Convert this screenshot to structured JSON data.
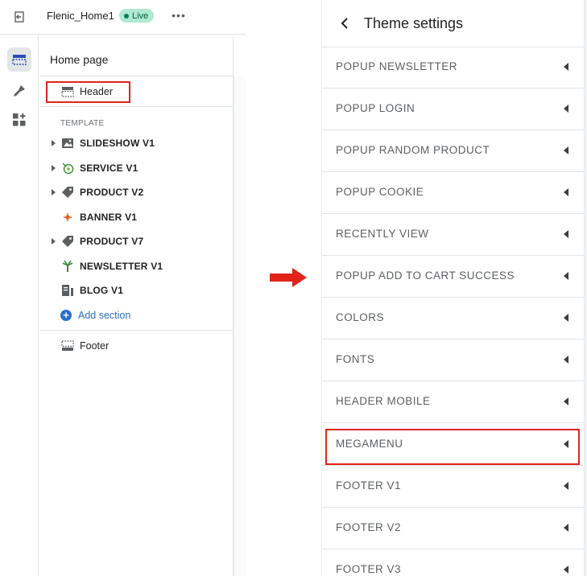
{
  "topbar": {
    "store_name": "Flenic_Home1",
    "status_badge": "Live",
    "more_label": "•••"
  },
  "rail": {
    "items": [
      {
        "icon": "sections-icon",
        "active": true
      },
      {
        "icon": "theme-brush-icon",
        "active": false
      },
      {
        "icon": "apps-icon",
        "active": false
      }
    ]
  },
  "tree": {
    "page_title": "Home page",
    "header_label": "Header",
    "template_label": "TEMPLATE",
    "sections": [
      {
        "label": "SLIDESHOW V1",
        "icon": "image-icon",
        "expandable": true
      },
      {
        "label": "SERVICE V1",
        "icon": "service-icon",
        "expandable": true
      },
      {
        "label": "PRODUCT V2",
        "icon": "tag-icon",
        "expandable": true
      },
      {
        "label": "BANNER V1",
        "icon": "banner-icon",
        "expandable": false
      },
      {
        "label": "PRODUCT V7",
        "icon": "tag-icon",
        "expandable": true
      },
      {
        "label": "NEWSLETTER V1",
        "icon": "newsletter-icon",
        "expandable": false
      },
      {
        "label": "BLOG V1",
        "icon": "blog-icon",
        "expandable": false
      }
    ],
    "add_section_label": "Add section",
    "footer_label": "Footer"
  },
  "settings": {
    "title": "Theme settings",
    "items": [
      "POPUP NEWSLETTER",
      "POPUP LOGIN",
      "POPUP RANDOM PRODUCT",
      "POPUP COOKIE",
      "RECENTLY VIEW",
      "POPUP ADD TO CART SUCCESS",
      "COLORS",
      "FONTS",
      "HEADER MOBILE",
      "MEGAMENU",
      "FOOTER V1",
      "FOOTER V2",
      "FOOTER V3"
    ],
    "highlighted_item": "MEGAMENU"
  },
  "colors": {
    "highlight": "#e2231a",
    "link": "#2c6ecb",
    "live_badge": "#aee9d1"
  }
}
